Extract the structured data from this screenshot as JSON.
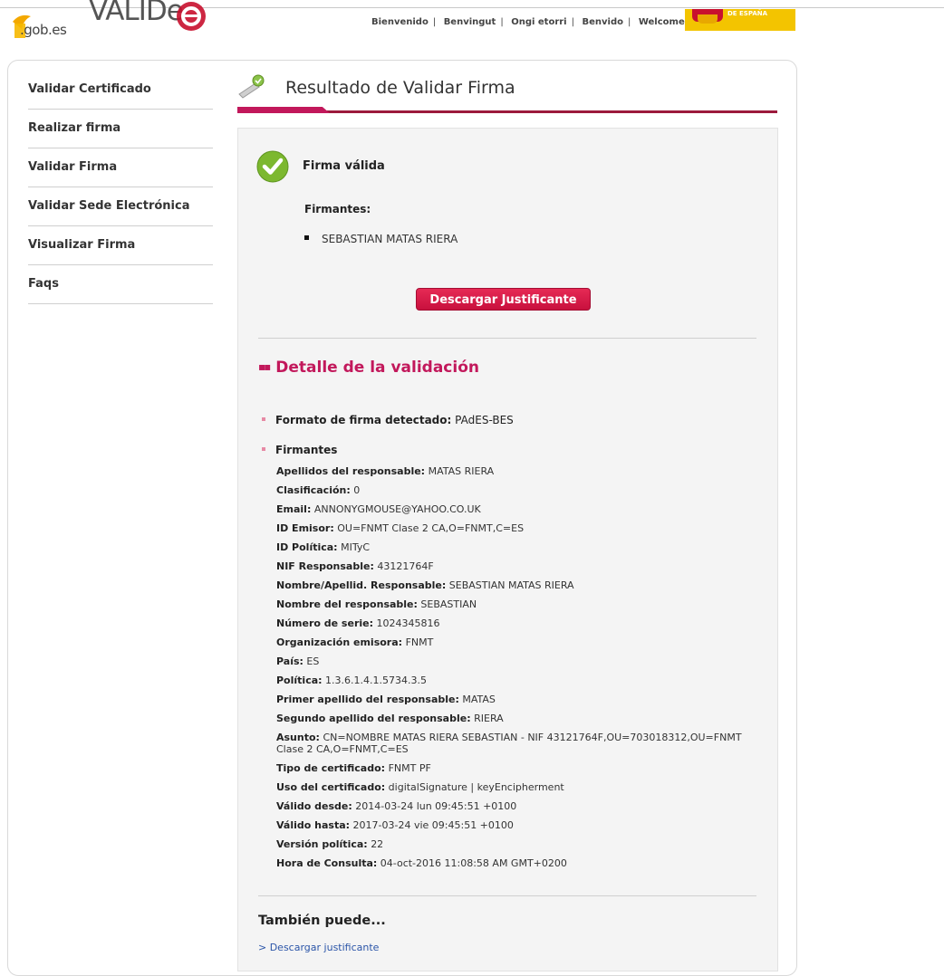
{
  "header": {
    "gob_logo_text": ".gob.es",
    "app_logo_text": "VALIDe",
    "languages": [
      "Bienvenido",
      "Benvingut",
      "Ongi etorri",
      "Benvido",
      "Welcome"
    ],
    "gov_badge_text": "DE ESPAÑA"
  },
  "sidebar": {
    "items": [
      {
        "label": "Validar Certificado"
      },
      {
        "label": "Realizar firma"
      },
      {
        "label": "Validar Firma"
      },
      {
        "label": "Validar Sede Electrónica"
      },
      {
        "label": "Visualizar Firma"
      },
      {
        "label": "Faqs"
      }
    ]
  },
  "main": {
    "title": "Resultado de Validar Firma",
    "status": "Firma válida",
    "signers_label": "Firmantes:",
    "signers": [
      "SEBASTIAN MATAS RIERA"
    ],
    "download_button": "Descargar Justificante",
    "detail_title": "Detalle de la validación",
    "detail_marker": "▪▪",
    "format_label": "Formato de firma detectado:",
    "format_value": "PAdES-BES",
    "signers_section_label": "Firmantes",
    "fields": [
      {
        "key": "Apellidos del responsable:",
        "value": "MATAS RIERA"
      },
      {
        "key": "Clasificación:",
        "value": "0"
      },
      {
        "key": "Email:",
        "value": "ANNONYGMOUSE@YAHOO.CO.UK"
      },
      {
        "key": "ID Emisor:",
        "value": "OU=FNMT Clase 2 CA,O=FNMT,C=ES"
      },
      {
        "key": "ID Política:",
        "value": "MITyC"
      },
      {
        "key": "NIF Responsable:",
        "value": "43121764F"
      },
      {
        "key": "Nombre/Apellid. Responsable:",
        "value": "SEBASTIAN MATAS RIERA"
      },
      {
        "key": "Nombre del responsable:",
        "value": "SEBASTIAN"
      },
      {
        "key": "Número de serie:",
        "value": "1024345816"
      },
      {
        "key": "Organización emisora:",
        "value": "FNMT"
      },
      {
        "key": "País:",
        "value": "ES"
      },
      {
        "key": "Política:",
        "value": "1.3.6.1.4.1.5734.3.5"
      },
      {
        "key": "Primer apellido del responsable:",
        "value": "MATAS"
      },
      {
        "key": "Segundo apellido del responsable:",
        "value": "RIERA"
      },
      {
        "key": "Asunto:",
        "value": "CN=NOMBRE MATAS RIERA SEBASTIAN - NIF 43121764F,OU=703018312,OU=FNMT Clase 2 CA,O=FNMT,C=ES"
      },
      {
        "key": "Tipo de certificado:",
        "value": "FNMT PF"
      },
      {
        "key": "Uso del certificado:",
        "value": "digitalSignature | keyEncipherment"
      },
      {
        "key": "Válido desde:",
        "value": "2014-03-24 lun 09:45:51 +0100"
      },
      {
        "key": "Válido hasta:",
        "value": "2017-03-24 vie 09:45:51 +0100"
      },
      {
        "key": "Versión política:",
        "value": "22"
      },
      {
        "key": "Hora de Consulta:",
        "value": "04-oct-2016 11:08:58 AM GMT+0200"
      }
    ],
    "also_title": "También puede...",
    "also_link": "> Descargar justificante"
  },
  "colors": {
    "accent": "#c2185b",
    "button": "#d81b4a",
    "success": "#7cb82f",
    "link": "#2b55a8"
  },
  "icons": [
    "gob-logo-icon",
    "valide-logo-icon",
    "spain-coat-of-arms-icon",
    "signature-pen-icon",
    "check-circle-icon"
  ]
}
